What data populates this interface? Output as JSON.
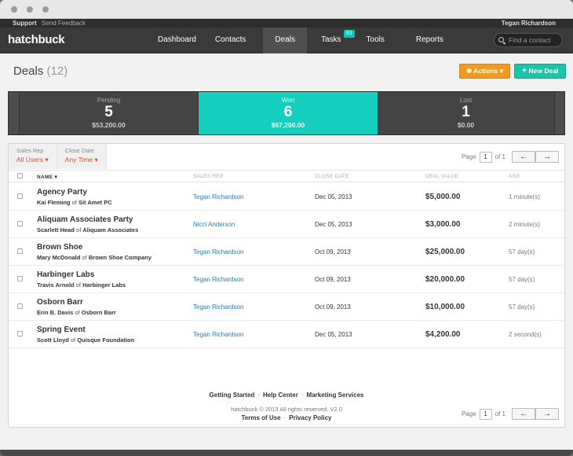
{
  "topbar": {
    "support": "Support",
    "feedback": "Send Feedback",
    "user": "Tegan Richardson"
  },
  "nav": {
    "logo": "hatchbuck",
    "items": [
      "Dashboard",
      "Contacts",
      "Deals",
      "Tasks",
      "Tools",
      "Reports"
    ],
    "active": "Deals",
    "tasks_badge": "93",
    "search_placeholder": "Find a contact"
  },
  "header": {
    "title": "Deals",
    "count": "(12)",
    "actions_label": "Actions",
    "new_deal_label": "New Deal"
  },
  "stats": [
    {
      "label": "Pending",
      "count": "5",
      "amount": "$53,200.00"
    },
    {
      "label": "Won",
      "count": "6",
      "amount": "$67,200.00"
    },
    {
      "label": "Lost",
      "count": "1",
      "amount": "$0.00"
    }
  ],
  "filters": {
    "sales_rep_label": "Sales Rep",
    "sales_rep_value": "All Users",
    "close_date_label": "Close Date",
    "close_date_value": "Any Time"
  },
  "pager": {
    "page_label": "Page",
    "page": "1",
    "of_label": "of 1"
  },
  "columns": {
    "name": "NAME",
    "sales_rep": "SALES REP",
    "close_date": "CLOSE DATE",
    "deal_value": "DEAL VALUE",
    "age": "AGE"
  },
  "deals": [
    {
      "name": "Agency Party",
      "contact": "Kai Fleming",
      "company": "Sit Amet PC",
      "rep": "Tegan Richardson",
      "close_date": "Dec 05, 2013",
      "value": "$5,000.00",
      "age": "1 minute(s)"
    },
    {
      "name": "Aliquam Associates Party",
      "contact": "Scarlett Head",
      "company": "Aliquam Associates",
      "rep": "Nicci Anderson",
      "close_date": "Dec 05, 2013",
      "value": "$3,000.00",
      "age": "2 minute(s)"
    },
    {
      "name": "Brown Shoe",
      "contact": "Mary McDonald",
      "company": "Brown Shoe Company",
      "rep": "Tegan Richardson",
      "close_date": "Oct 09, 2013",
      "value": "$25,000.00",
      "age": "57 day(s)"
    },
    {
      "name": "Harbinger Labs",
      "contact": "Travis Arnold",
      "company": "Harbinger Labs",
      "rep": "Tegan Richardson",
      "close_date": "Oct 09, 2013",
      "value": "$20,000.00",
      "age": "57 day(s)"
    },
    {
      "name": "Osborn Barr",
      "contact": "Erin B. Davis",
      "company": "Osborn Barr",
      "rep": "Tegan Richardson",
      "close_date": "Oct 09, 2013",
      "value": "$10,000.00",
      "age": "57 day(s)"
    },
    {
      "name": "Spring Event",
      "contact": "Scott Lloyd",
      "company": "Quisque Foundation",
      "rep": "Tegan Richardson",
      "close_date": "Dec 05, 2013",
      "value": "$4,200.00",
      "age": "2 second(s)"
    }
  ],
  "of_word": "of",
  "footer": {
    "links": [
      "Getting Started",
      "Help Center",
      "Marketing Services"
    ],
    "copyright": "hatchbuck © 2013 All rights reserved. V2.0",
    "legal": [
      "Terms of Use",
      "Privacy Policy"
    ]
  },
  "colors": {
    "accent_teal": "#14cfbd",
    "actions_orange": "#f39a1d",
    "link_blue": "#2a7ab8",
    "filter_orange": "#d5551f"
  }
}
